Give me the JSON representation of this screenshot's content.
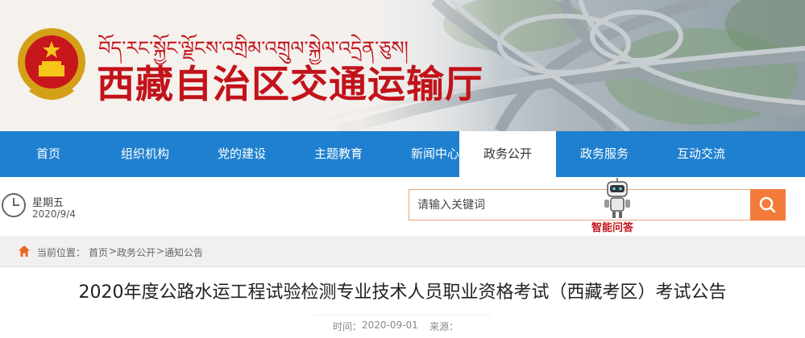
{
  "header": {
    "tibetan_title": "བོད་རང་སྐྱོང་ལྗོངས་འགྲིམ་འགྲུལ་སྐྱེལ་འདྲེན་ཅུས།",
    "site_title": "西藏自治区交通运输厅",
    "colors": {
      "title": "#c2131b"
    }
  },
  "nav": {
    "items": [
      {
        "label": "首页"
      },
      {
        "label": "组织机构"
      },
      {
        "label": "党的建设"
      },
      {
        "label": "主题教育"
      },
      {
        "label": "新闻中心"
      },
      {
        "label": "政务公开",
        "active": true
      },
      {
        "label": "政务服务"
      },
      {
        "label": "互动交流"
      }
    ],
    "colors": {
      "bar": "#1e80cf"
    }
  },
  "toolbar": {
    "weekday": "星期五",
    "date": "2020/9/4",
    "search_placeholder": "请输入关键词",
    "robot_label": "智能问答",
    "icons": {
      "clock": "clock-icon",
      "search": "search-icon",
      "robot": "robot-icon"
    },
    "colors": {
      "search_button": "#f27b3a"
    }
  },
  "breadcrumb": {
    "prefix": "当前位置：",
    "items": [
      "首页",
      "政务公开",
      "通知公告"
    ],
    "separator": ">"
  },
  "article": {
    "title": "2020年度公路水运工程试验检测专业技术人员职业资格考试（西藏考区）考试公告",
    "time_label": "时间：",
    "time_value": "2020-09-01",
    "source_label": "来源："
  }
}
